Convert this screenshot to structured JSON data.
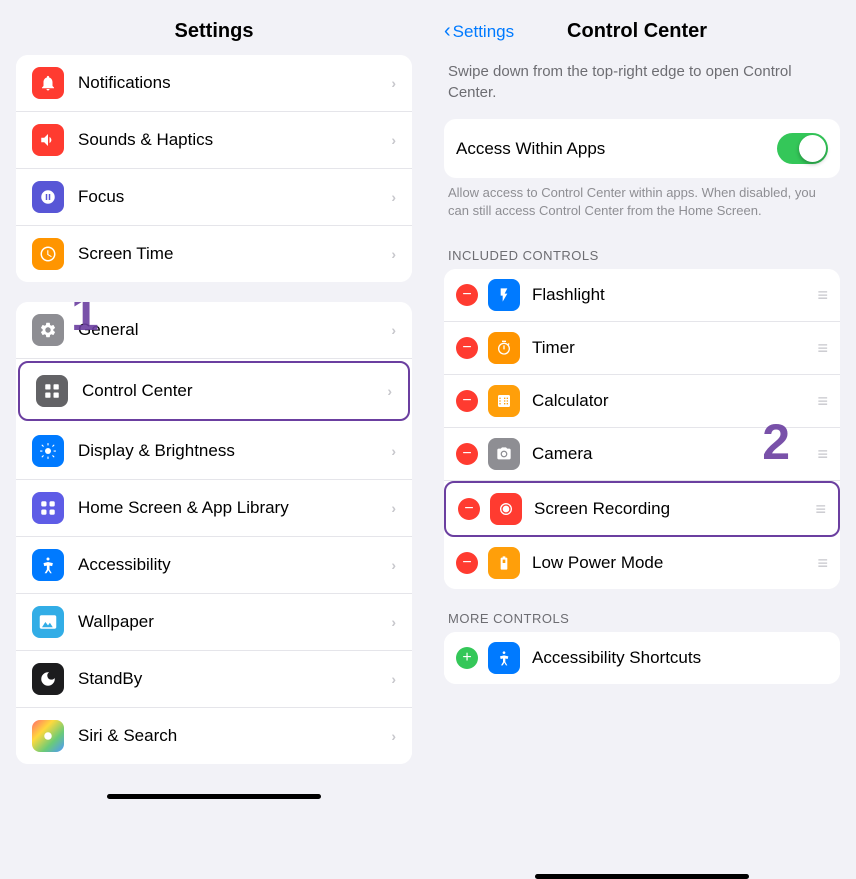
{
  "left": {
    "header": "Settings",
    "group1": [
      {
        "id": "notifications",
        "label": "Notifications",
        "iconBg": "icon-red",
        "iconChar": "🔔"
      },
      {
        "id": "sounds",
        "label": "Sounds & Haptics",
        "iconBg": "icon-red-sound",
        "iconChar": "🔊"
      },
      {
        "id": "focus",
        "label": "Focus",
        "iconBg": "icon-purple",
        "iconChar": "🌙"
      },
      {
        "id": "screentime",
        "label": "Screen Time",
        "iconBg": "icon-orange",
        "iconChar": "⏳"
      }
    ],
    "group2": [
      {
        "id": "general",
        "label": "General",
        "iconBg": "icon-gray",
        "iconChar": "⚙️",
        "badge": "1"
      },
      {
        "id": "controlcenter",
        "label": "Control Center",
        "iconBg": "icon-control",
        "iconChar": "⊞",
        "highlighted": true
      },
      {
        "id": "displaybrightness",
        "label": "Display & Brightness",
        "iconBg": "icon-blue",
        "iconChar": "☀️"
      },
      {
        "id": "homescreenapp",
        "label": "Home Screen & App Library",
        "iconBg": "icon-indigo",
        "iconChar": "⊞"
      },
      {
        "id": "accessibility",
        "label": "Accessibility",
        "iconBg": "icon-blue",
        "iconChar": "♿"
      },
      {
        "id": "wallpaper",
        "label": "Wallpaper",
        "iconBg": "icon-cyan",
        "iconChar": "🖼"
      },
      {
        "id": "standby",
        "label": "StandBy",
        "iconBg": "icon-gray",
        "iconChar": "☾"
      },
      {
        "id": "siri",
        "label": "Siri & Search",
        "iconBg": "icon-multicolor",
        "iconChar": "◎"
      }
    ]
  },
  "right": {
    "backLabel": "Settings",
    "title": "Control Center",
    "description": "Swipe down from the top-right edge to open Control Center.",
    "accessWithinApps": {
      "label": "Access Within Apps",
      "description": "Allow access to Control Center within apps. When disabled, you can still access Control Center from the Home Screen."
    },
    "includedControlsHeader": "INCLUDED CONTROLS",
    "includedControls": [
      {
        "id": "flashlight",
        "name": "Flashlight",
        "iconBg": "icon-blue-flash",
        "iconChar": "🔦"
      },
      {
        "id": "timer",
        "name": "Timer",
        "iconBg": "icon-orange-timer",
        "iconChar": "⏱"
      },
      {
        "id": "calculator",
        "name": "Calculator",
        "iconBg": "icon-yellow-calc",
        "iconChar": "🧮"
      },
      {
        "id": "camera",
        "name": "Camera",
        "iconBg": "icon-gray-cam",
        "iconChar": "📷",
        "badge2": true
      },
      {
        "id": "screenrecording",
        "name": "Screen Recording",
        "iconBg": "icon-red-rec",
        "iconChar": "⏺",
        "highlighted": true
      },
      {
        "id": "lowpowermode",
        "name": "Low Power Mode",
        "iconBg": "icon-yellow-power",
        "iconChar": "🔋"
      }
    ],
    "moreControlsHeader": "MORE CONTROLS",
    "moreControls": [
      {
        "id": "accessibilityshortcuts",
        "name": "Accessibility Shortcuts",
        "iconBg": "icon-blue-access",
        "iconChar": "♿"
      }
    ],
    "badge2Label": "2"
  }
}
